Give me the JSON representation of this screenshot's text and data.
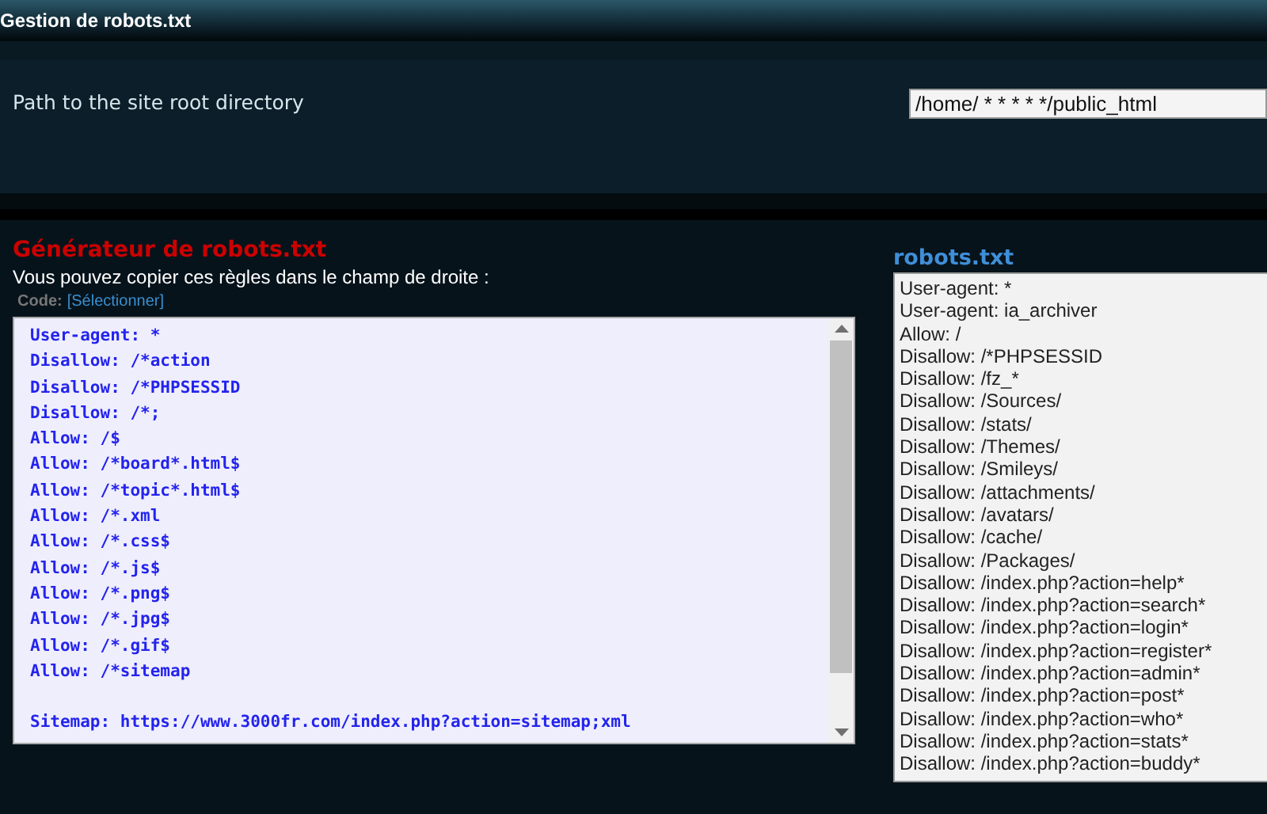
{
  "header": {
    "title": "Gestion de robots.txt"
  },
  "path_setting": {
    "label": "Path to the site root directory",
    "value": "/home/ * * * * */public_html"
  },
  "generator": {
    "title": "Générateur de robots.txt",
    "hint": "Vous pouvez copier ces règles dans le champ de droite :",
    "code_label": "Code:",
    "select_link": "[Sélectionner]",
    "lines": [
      "User-agent: *",
      "Disallow: /*action",
      "Disallow: /*PHPSESSID",
      "Disallow: /*;",
      "Allow: /$",
      "Allow: /*board*.html$",
      "Allow: /*topic*.html$",
      "Allow: /*.xml",
      "Allow: /*.css$",
      "Allow: /*.js$",
      "Allow: /*.png$",
      "Allow: /*.jpg$",
      "Allow: /*.gif$",
      "Allow: /*sitemap"
    ],
    "sitemap_line": "Sitemap: https://www.3000fr.com/index.php?action=sitemap;xml"
  },
  "robots": {
    "title": "robots.txt",
    "lines": [
      "User-agent: *",
      "User-agent: ia_archiver",
      "Allow: /",
      "Disallow: /*PHPSESSID",
      "Disallow: /fz_*",
      "Disallow: /Sources/",
      "Disallow: /stats/",
      "Disallow: /Themes/",
      "Disallow: /Smileys/",
      "Disallow: /attachments/",
      "Disallow: /avatars/",
      "Disallow: /cache/",
      "Disallow: /Packages/",
      "Disallow: /index.php?action=help*",
      "Disallow: /index.php?action=search*",
      "Disallow: /index.php?action=login*",
      "Disallow: /index.php?action=register*",
      "Disallow: /index.php?action=admin*",
      "Disallow: /index.php?action=post*",
      "Disallow: /index.php?action=who*",
      "Disallow: /index.php?action=stats*",
      "Disallow: /index.php?action=buddy*"
    ]
  }
}
